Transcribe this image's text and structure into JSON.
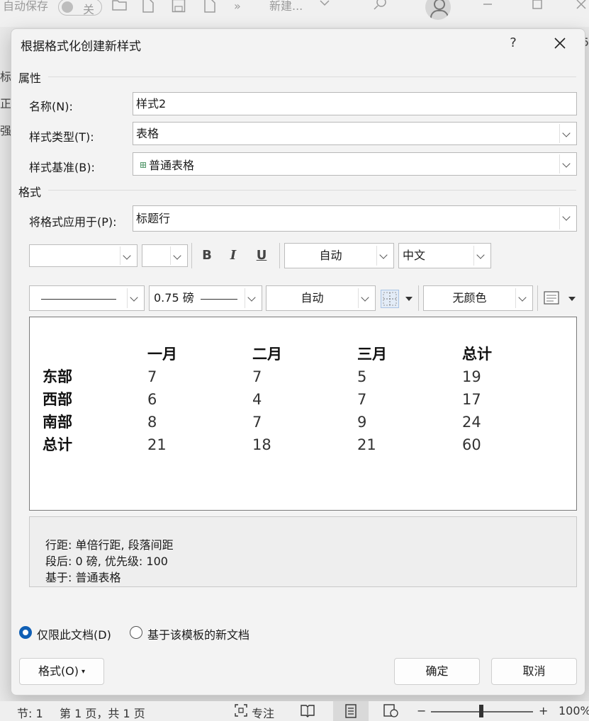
{
  "app": {
    "autosave_label": "自动保存",
    "autosave_state": "关",
    "breadcrumb_more": "»",
    "doc_title": "新建...",
    "left_strip": [
      "标题",
      "正文",
      "强调"
    ],
    "right_strip_char": "5"
  },
  "dialog": {
    "title": "根据格式化创建新样式",
    "help": "?",
    "close": "✕",
    "properties_section": "属性",
    "name_label": "名称(N):",
    "name_value": "样式2",
    "style_type_label": "样式类型(T):",
    "style_type_value": "表格",
    "style_based_label": "样式基准(B):",
    "style_based_value": "普通表格",
    "format_section": "格式",
    "apply_to_label": "将格式应用于(P):",
    "apply_to_value": "标题行",
    "toolbar1": {
      "font_value": "",
      "size_value": "",
      "bold": "B",
      "italic": "I",
      "underline": "U",
      "color_value": "自动",
      "script_value": "中文"
    },
    "toolbar2": {
      "border_style_value": "",
      "border_width_value": "0.75 磅",
      "border_color_value": "自动",
      "shading_value": "无颜色"
    },
    "preview": {
      "header": [
        "",
        "一月",
        "二月",
        "三月",
        "总计"
      ],
      "rows": [
        [
          "东部",
          "7",
          "7",
          "5",
          "19"
        ],
        [
          "西部",
          "6",
          "4",
          "7",
          "17"
        ],
        [
          "南部",
          "8",
          "7",
          "9",
          "24"
        ],
        [
          "总计",
          "21",
          "18",
          "21",
          "60"
        ]
      ]
    },
    "description": [
      "行距: 单倍行距, 段落间距",
      "段后: 0 磅, 优先级: 100",
      "基于: 普通表格"
    ],
    "radio_this_doc": "仅限此文档(D)",
    "radio_new_docs": "基于该模板的新文档",
    "format_button": "格式(O)",
    "ok_button": "确定",
    "cancel_button": "取消"
  },
  "statusbar": {
    "section": "节: 1",
    "page": "第 1 页，共 1 页",
    "focus": "专注",
    "zoom_minus": "−",
    "zoom_plus": "+",
    "zoom": "100%"
  }
}
